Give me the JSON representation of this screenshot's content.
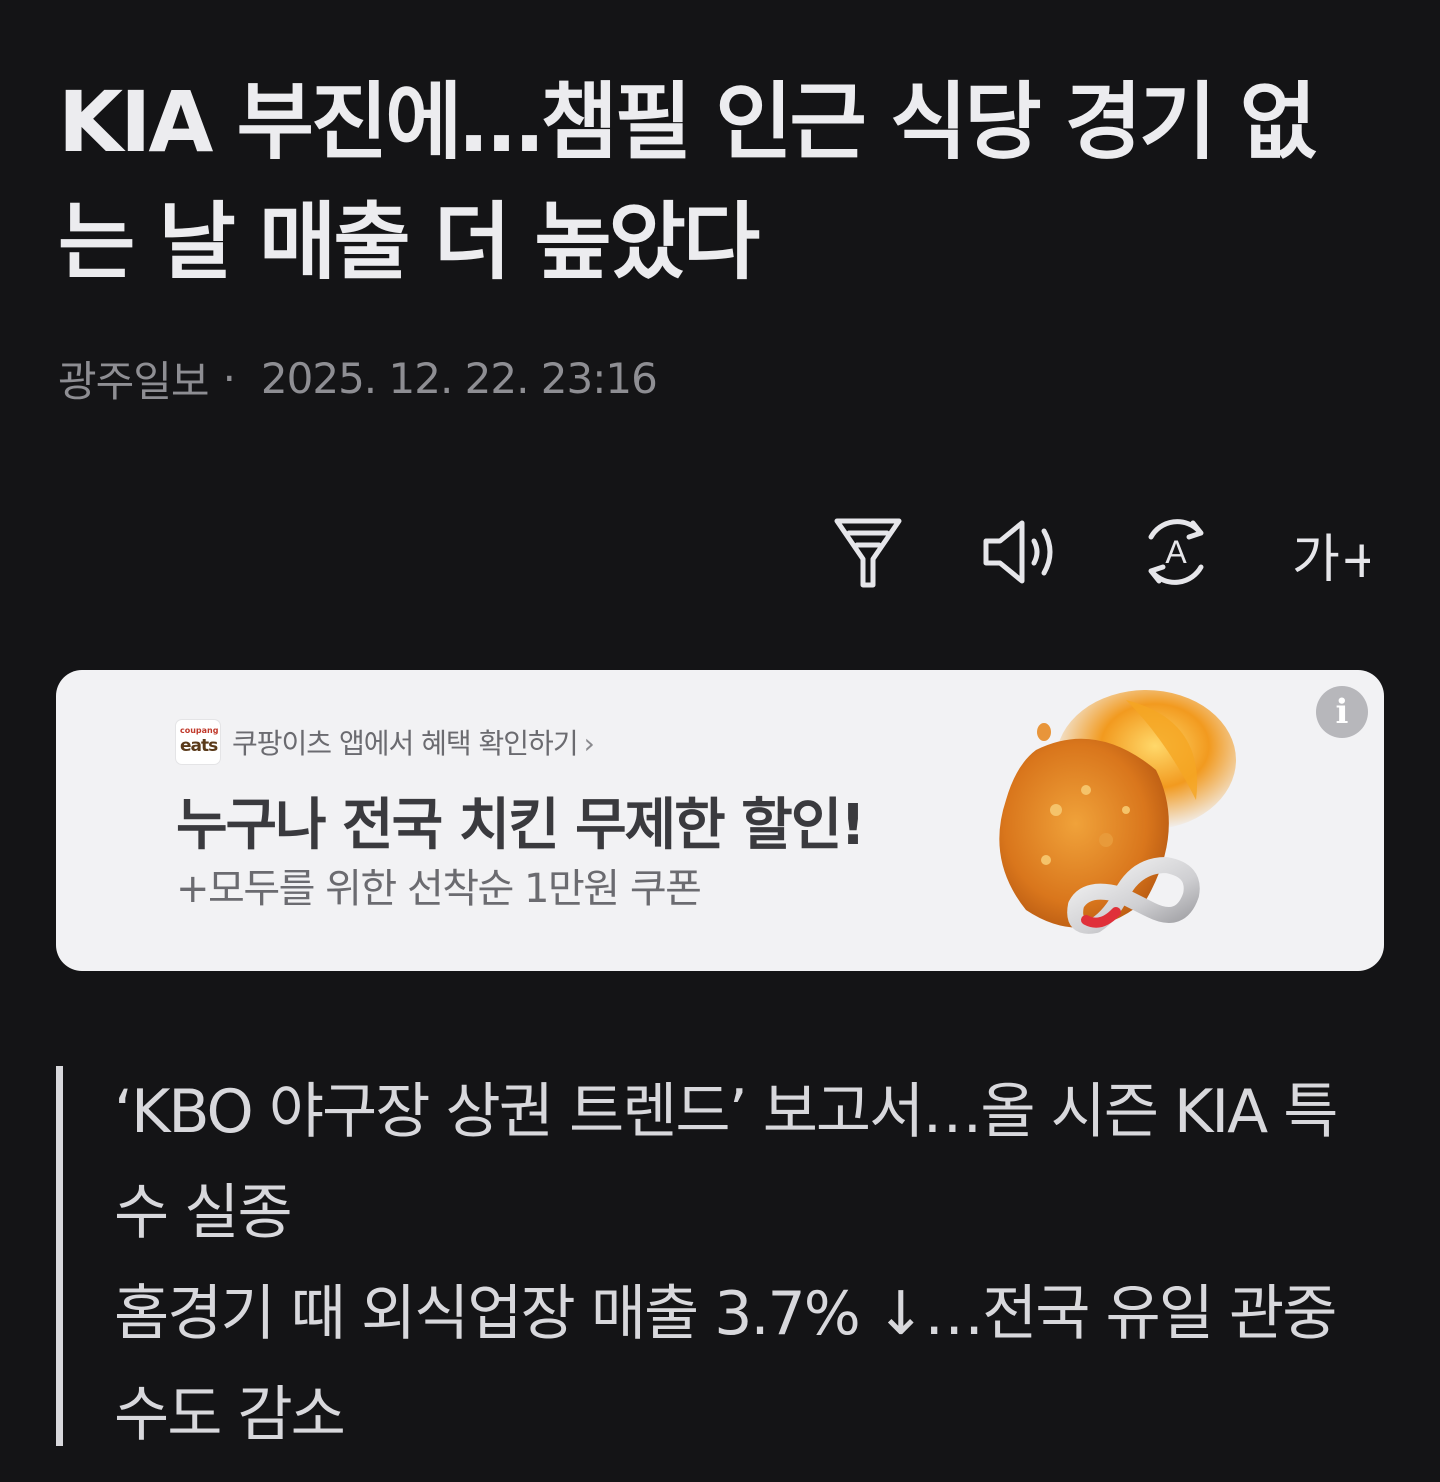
{
  "article": {
    "title": "KIA 부진에…챔필 인근 식당 경기 없는 날 매출 더 높았다",
    "source": "광주일보",
    "separator": "·",
    "datetime": "2025. 12. 22. 23:16"
  },
  "toolbar": {
    "tools": [
      {
        "icon": "filter-icon"
      },
      {
        "icon": "speaker-icon"
      },
      {
        "icon": "auto-translate-icon",
        "glyph": "A"
      },
      {
        "icon": "font-size-icon",
        "glyph": "가+"
      }
    ]
  },
  "ad": {
    "brand_small": "coupang",
    "brand_big": "eats",
    "cta": "쿠팡이츠 앱에서 혜택 확인하기",
    "cta_chevron": "›",
    "title": "누구나 전국 치킨 무제한 할인!",
    "subtitle": "+모두를 위한 선착순 1만원 쿠폰",
    "info_glyph": "i",
    "colors": {
      "background": "#f2f2f4",
      "title": "#3a3a3e"
    }
  },
  "summary": {
    "line1": "‘KBO 야구장 상권 트렌드’ 보고서…올 시즌 KIA 특수 실종",
    "line2": "홈경기 때 외식업장 매출 3.7% ↓…전국 유일 관중수도 감소"
  }
}
